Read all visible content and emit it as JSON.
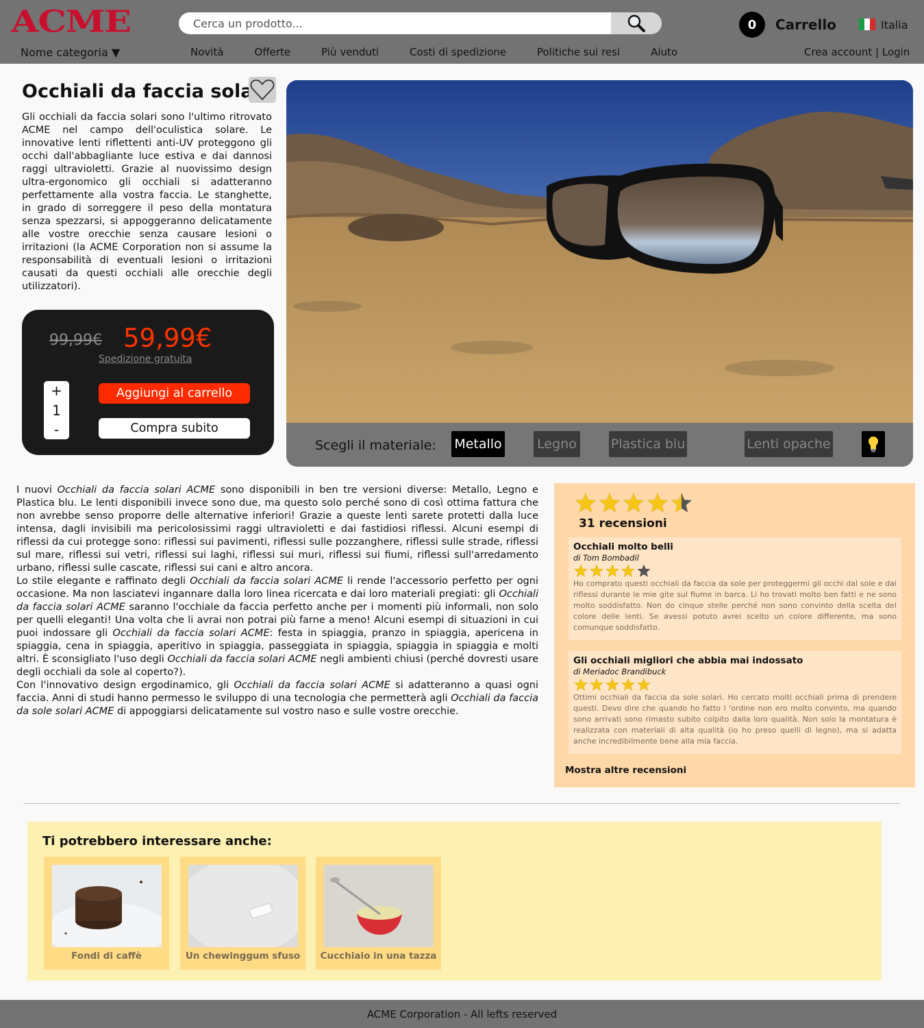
{
  "header": {
    "logo": "ACME",
    "category_label": "Nome categoria ▼",
    "search_placeholder": "Cerca un prodotto...",
    "nav": [
      "Novità",
      "Offerte",
      "Più venduti",
      "Costi di spedizione",
      "Politiche sui resi",
      "Aiuto"
    ],
    "cart_count": "0",
    "cart_label": "Carrello",
    "language": "Italia",
    "account": "Crea account | Login"
  },
  "product": {
    "title": "Occhiali da faccia solari",
    "description": "Gli occhiali da faccia solari sono l'ultimo ritrovato ACME nel campo dell'oculistica solare. Le innovative lenti riflettenti anti-UV proteggono gli occhi dall'abbagliante luce estiva e dai dannosi raggi ultravioletti. Grazie al nuovissimo design ultra-ergonomico gli occhiali si adatteranno perfettamente alla vostra faccia. Le stanghette, in grado di sorreggere il peso della montatura senza spezzarsi, si appoggeranno delicatamente alle vostre orecchie senza causare lesioni o irritazioni (la ACME Corporation non si assume la responsabilità di eventuali lesioni o irritazioni causati da questi occhiali alle orecchie degli utilizzatori).",
    "old_price": "99,99€",
    "price": "59,99€",
    "shipping": "Spedizione gratuita",
    "qty_plus": "+",
    "qty": "1",
    "qty_minus": "-",
    "add_to_cart": "Aggiungi al carrello",
    "buy_now": "Compra subito"
  },
  "viewer": {
    "material_label": "Scegli il materiale:",
    "materials": [
      "Metallo",
      "Legno",
      "Plastica blu"
    ],
    "lens_option": "Lenti opache",
    "icon": "lightbulb-icon"
  },
  "long_description": {
    "p1_a": "I nuovi ",
    "p1_b": "Occhiali da faccia solari ACME",
    "p1_c": " sono disponibili in ben tre versioni diverse: Metallo, Legno e Plastica blu. Le lenti disponibili invece sono due, ma questo solo perché sono di così ottima fattura che non avrebbe senso proporre delle alternative inferiori! Grazie a queste lenti sarete protetti dalla luce intensa, dagli invisibili ma pericolosissimi raggi ultravioletti e dai fastidiosi riflessi. Alcuni esempi di riflessi da cui protegge sono: riflessi sui pavimenti, riflessi sulle pozzanghere, riflessi sulle strade, riflessi sul mare, riflessi sui vetri, riflessi sui laghi, riflessi sui muri, riflessi sui fiumi, riflessi sull'arredamento urbano, riflessi sulle cascate, riflessi sui cani e altro ancora.",
    "p2_a": "Lo stile elegante e raffinato degli ",
    "p2_b": "Occhiali da faccia solari ACME",
    "p2_c": " li rende l'accessorio perfetto per ogni occasione. Ma non lasciatevi ingannare dalla loro linea ricercata e dai loro materiali pregiati: gli ",
    "p2_d": "Occhiali da faccia solari ACME",
    "p2_e": " saranno l'occhiale da faccia perfetto anche per i momenti più informali, non solo per quelli eleganti! Una volta che li avrai non potrai più farne a meno! Alcuni esempi di situazioni in cui puoi indossare gli ",
    "p2_f": "Occhiali da faccia solari ACME",
    "p2_g": ": festa in spiaggia, pranzo in spiaggia, apericena in spiaggia, cena in spiaggia, aperitivo in spiaggia, passeggiata in spiaggia, spiaggia in spiaggia e molti altri. È sconsigliato l'uso degli ",
    "p2_h": "Occhiali da faccia solari ACME",
    "p2_i": " negli ambienti chiusi (perché dovresti usare degli occhiali da sole al coperto?).",
    "p3_a": "Con l'innovativo design ergodinamico, gli ",
    "p3_b": "Occhiali da faccia solari ACME",
    "p3_c": " si adatteranno a quasi ogni faccia. Anni di studi hanno permesso le sviluppo di una tecnologia che permetterà agli ",
    "p3_d": "Occhiali da faccia da sole solari ACME",
    "p3_e": " di appoggiarsi delicatamente sul vostro naso e sulle vostre orecchie."
  },
  "reviews": {
    "rating": 4.5,
    "count_label": "31 recensioni",
    "items": [
      {
        "title": "Occhiali molto belli",
        "author": "di Tom Bombadil",
        "stars": 4,
        "text": "Ho comprato questi occhiali da faccia da sole per proteggermi gli occhi dal sole e dai riflessi durante le mie gite sul fiume in barca. Li ho trovati molto ben fatti e ne sono molto soddisfatto. Non do cinque stelle perché non sono convinto della scelta del colore delle lenti. Se avessi potuto avrei scelto un colore differente, ma sono comunque soddisfatto."
      },
      {
        "title": "Gli occhiali migliori che abbia mai indossato",
        "author": "di Meriadoc Brandibuck",
        "stars": 5,
        "text": "Ottimi occhiali da faccia da sole solari. Ho cercato molti occhiali prima di prendere questi. Devo dire che quando ho fatto l 'ordine non ero molto convinto, ma quando sono arrivati sono rimasto subito colpito dalla loro qualità. Non solo la montatura è realizzata con materiali di alta qualità (io ho preso quelli di legno), ma si adatta anche incredibilmente bene alla mia faccia."
      }
    ],
    "more_label": "Mostra altre recensioni"
  },
  "related": {
    "title": "Ti potrebbero interessare anche:",
    "items": [
      {
        "name": "Fondi di caffè"
      },
      {
        "name": "Un chewinggum sfuso"
      },
      {
        "name": "Cucchiaio in una tazza"
      }
    ]
  },
  "footer": {
    "text": "ACME Corporation - All lefts reserved"
  },
  "colors": {
    "header": "#737373",
    "price": "#ff3300",
    "cart_button": "#ff2a00",
    "reviews_bg": "#ffd8aa",
    "related_bg": "#fdf0b3",
    "star": "#f5c518"
  }
}
